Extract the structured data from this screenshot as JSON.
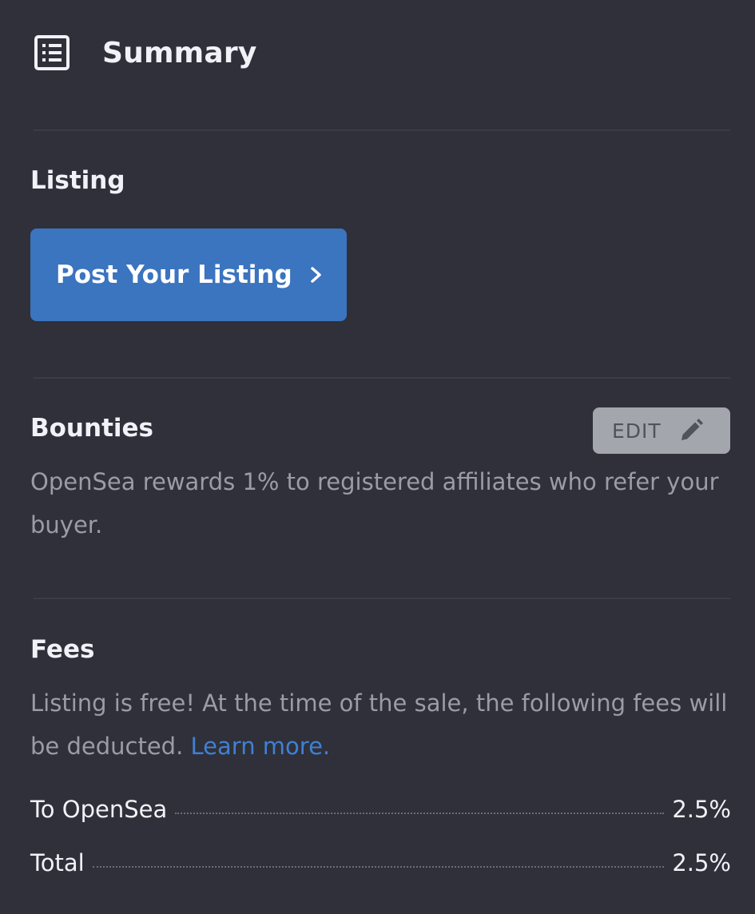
{
  "header": {
    "icon": "list-icon",
    "title": "Summary"
  },
  "listing": {
    "title": "Listing",
    "button_label": "Post Your Listing",
    "button_icon": "chevron-right-icon",
    "button_color": "#3b74bf"
  },
  "bounties": {
    "title": "Bounties",
    "edit_label": "EDIT",
    "edit_icon": "pencil-icon",
    "description": "OpenSea rewards 1% to registered affiliates who refer your buyer."
  },
  "fees": {
    "title": "Fees",
    "description": "Listing is free! At the time of the sale, the following fees will be deducted.",
    "learn_more": "Learn more.",
    "link_color": "#3f80d4",
    "rows": [
      {
        "name": "To OpenSea",
        "value": "2.5%"
      },
      {
        "name": "Total",
        "value": "2.5%"
      }
    ]
  },
  "colors": {
    "background": "#2f3039",
    "divider": "#3a3c47",
    "muted_text": "#9a9ca6"
  }
}
